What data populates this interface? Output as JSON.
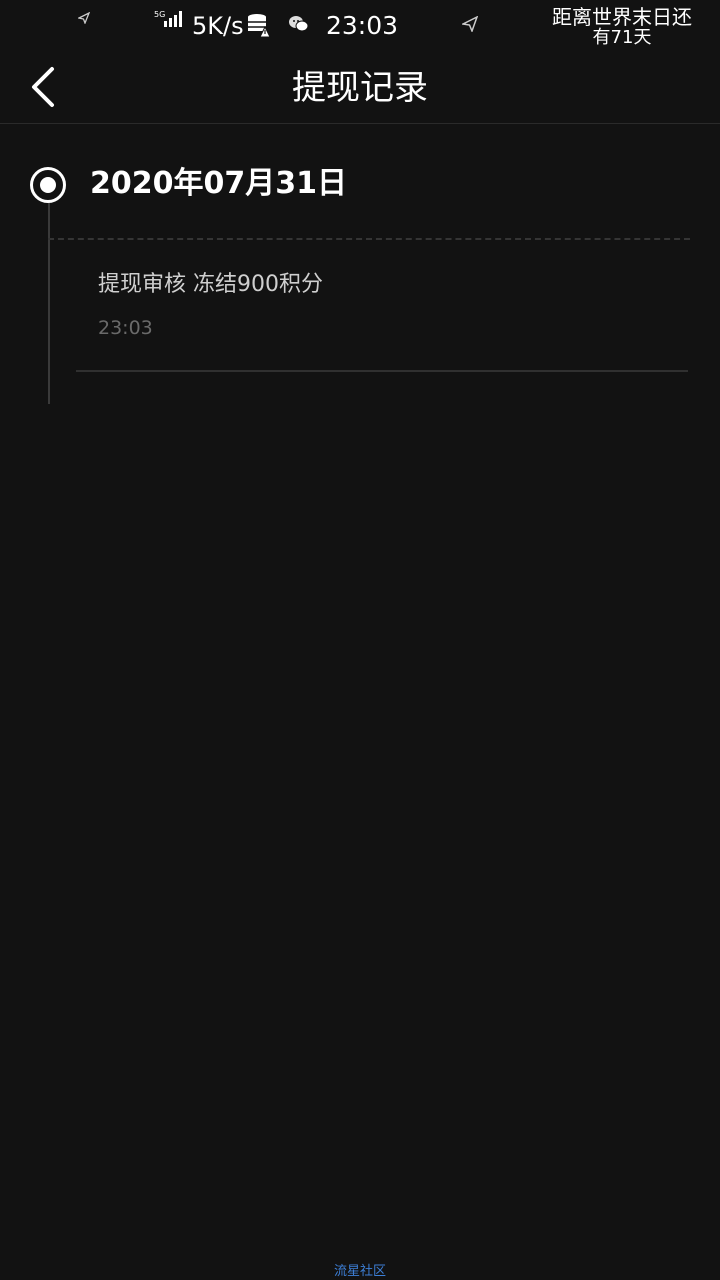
{
  "status_bar": {
    "network": "5G",
    "speed": "5K/s",
    "time": "23:03",
    "countdown_line1": "距离世界末日还",
    "countdown_line2": "有71天"
  },
  "header": {
    "title": "提现记录"
  },
  "timeline": [
    {
      "date": "2020年07月31日",
      "records": [
        {
          "description": "提现审核 冻结900积分",
          "time": "23:03"
        }
      ]
    }
  ],
  "footer": {
    "label": "流星社区",
    "color": "#3d7fd6"
  },
  "icons": [
    "send-icon",
    "signal-5g-icon",
    "database-alert-icon",
    "wechat-icon",
    "back-chevron-icon"
  ]
}
